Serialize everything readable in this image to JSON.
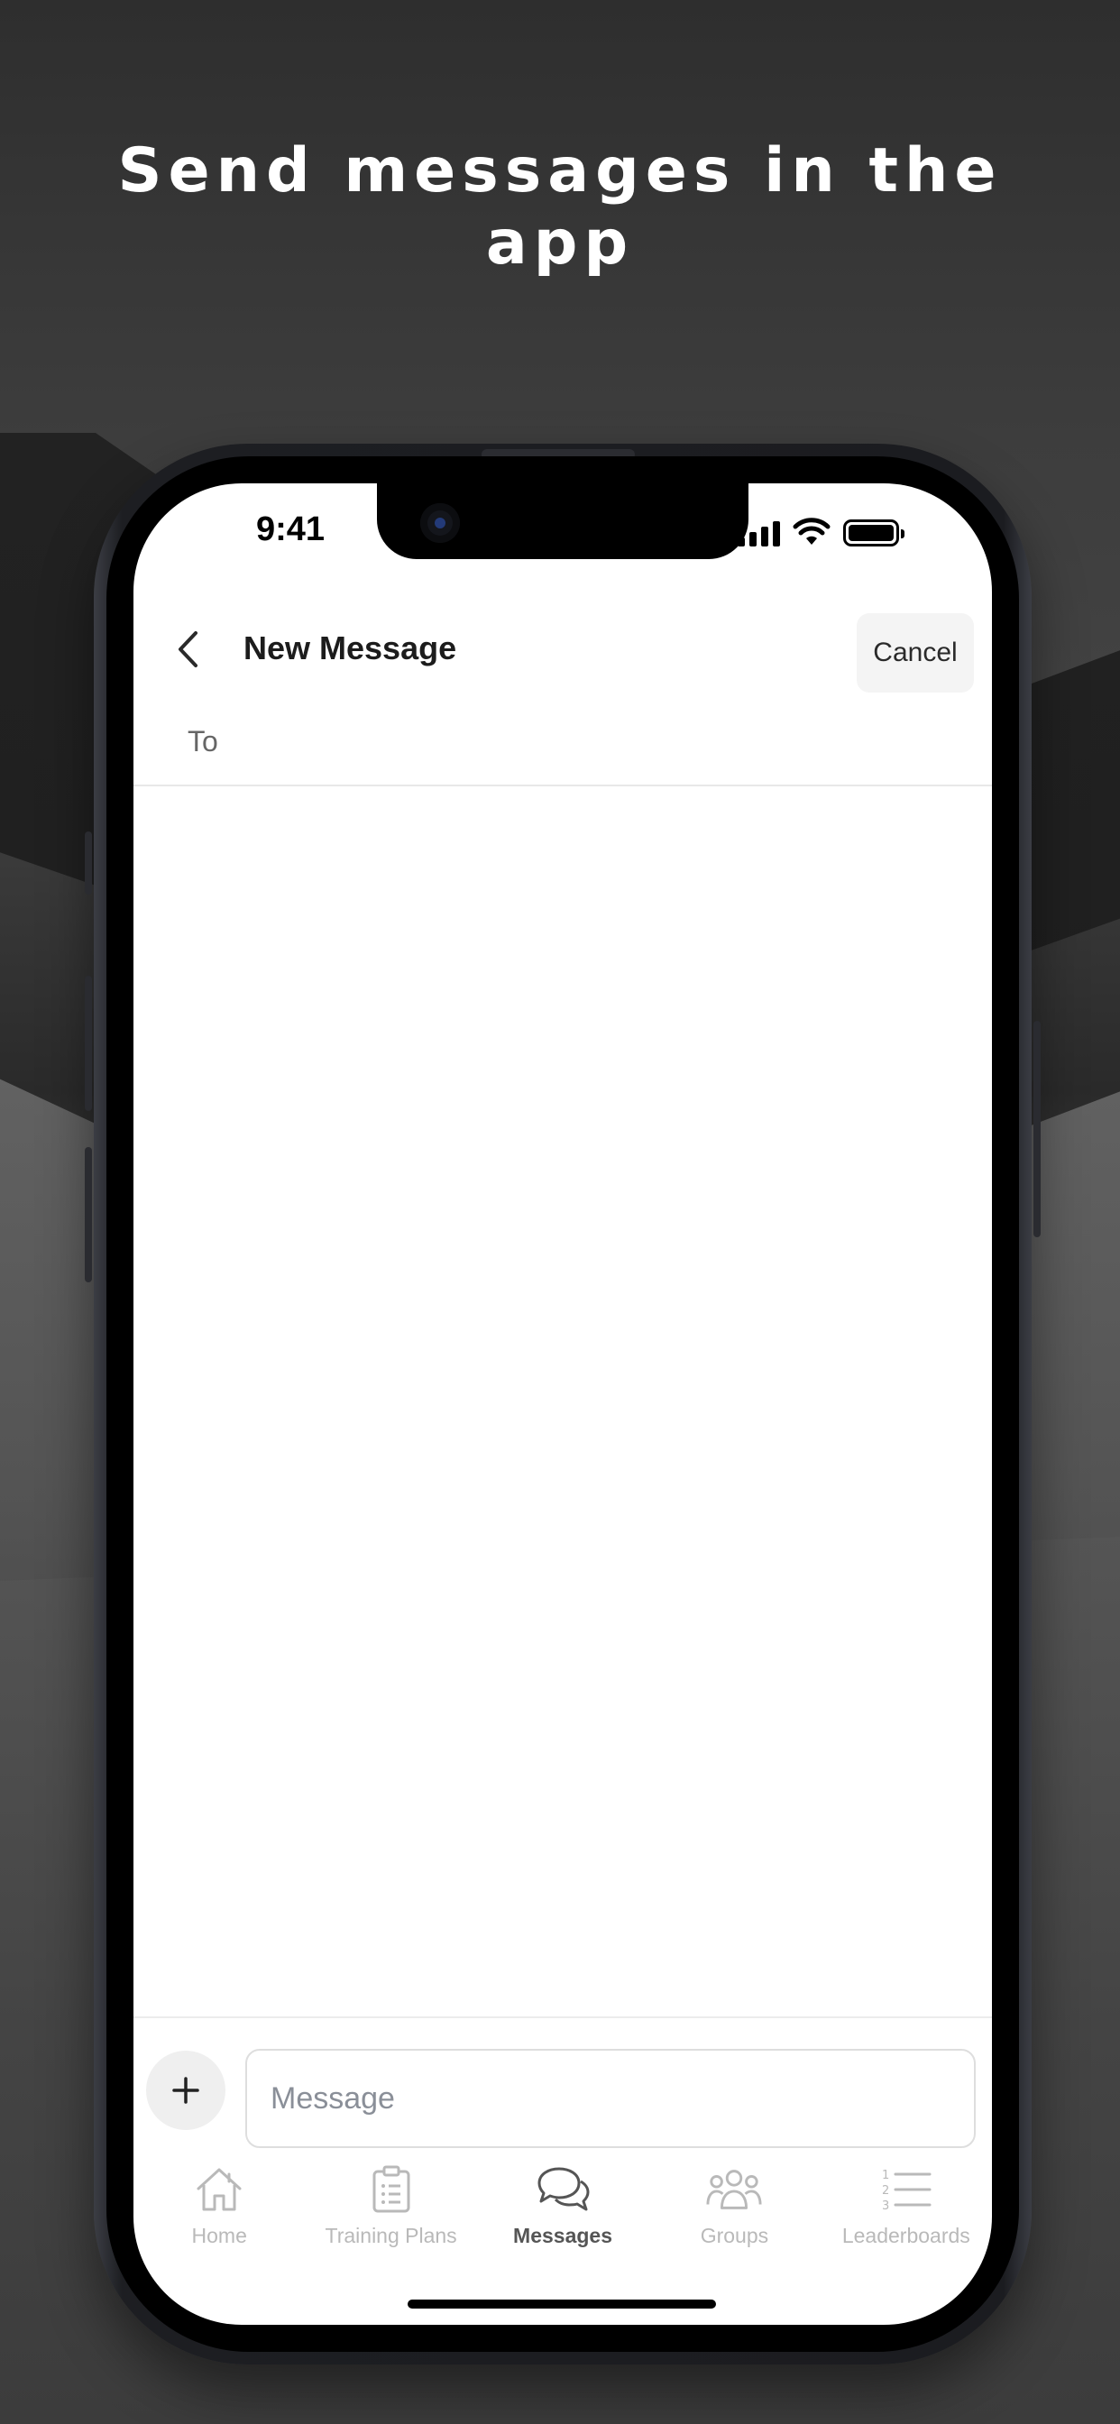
{
  "headline": {
    "line1": "Send messages in the",
    "line2": "app"
  },
  "status_bar": {
    "time": "9:41"
  },
  "header": {
    "title": "New Message",
    "cancel_label": "Cancel"
  },
  "recipient": {
    "label": "To",
    "value": ""
  },
  "composer": {
    "placeholder": "Message",
    "value": ""
  },
  "tabs": [
    {
      "label": "Home",
      "icon": "home-icon",
      "active": false
    },
    {
      "label": "Training Plans",
      "icon": "clipboard-icon",
      "active": false
    },
    {
      "label": "Messages",
      "icon": "chat-bubbles-icon",
      "active": true
    },
    {
      "label": "Groups",
      "icon": "group-icon",
      "active": false
    },
    {
      "label": "Leaderboards",
      "icon": "numbered-list-icon",
      "active": false
    }
  ],
  "colors": {
    "background": "#3a3a3a",
    "screen": "#ffffff",
    "active_tab": "#555555",
    "inactive_tab": "#b9b9b9"
  }
}
